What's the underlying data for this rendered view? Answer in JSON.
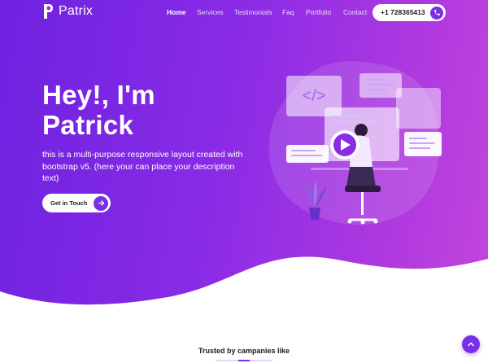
{
  "brand": {
    "name": "Patrix",
    "logo_icon": "p-logo-icon"
  },
  "nav": {
    "items": [
      {
        "label": "Home",
        "active": true
      },
      {
        "label": "Services",
        "active": false
      },
      {
        "label": "Testimonials",
        "active": false
      },
      {
        "label": "Faq",
        "active": false
      },
      {
        "label": "Portfolio",
        "active": false
      },
      {
        "label": "Contact",
        "active": false
      }
    ],
    "phone": {
      "label": "+1 728365413",
      "icon": "phone-icon"
    }
  },
  "hero": {
    "headline_line1": "Hey!, I'm",
    "headline_line2": "Patrick",
    "description": "this is a multi-purpose responsive layout created with bootstrap v5. (here your can place your description text)",
    "cta_label": "Get in Touch",
    "cta_icon": "arrow-right-icon",
    "illustration": "developer-at-desk-illustration"
  },
  "trusted": {
    "label": "Trusted by campanies like"
  },
  "scroll_top": {
    "icon": "chevron-up-icon"
  },
  "colors": {
    "accent": "#7a2ee6",
    "gradient_start": "#6d22e0",
    "gradient_end": "#c447dc",
    "text_dark": "#1b1b1b",
    "white": "#ffffff"
  }
}
